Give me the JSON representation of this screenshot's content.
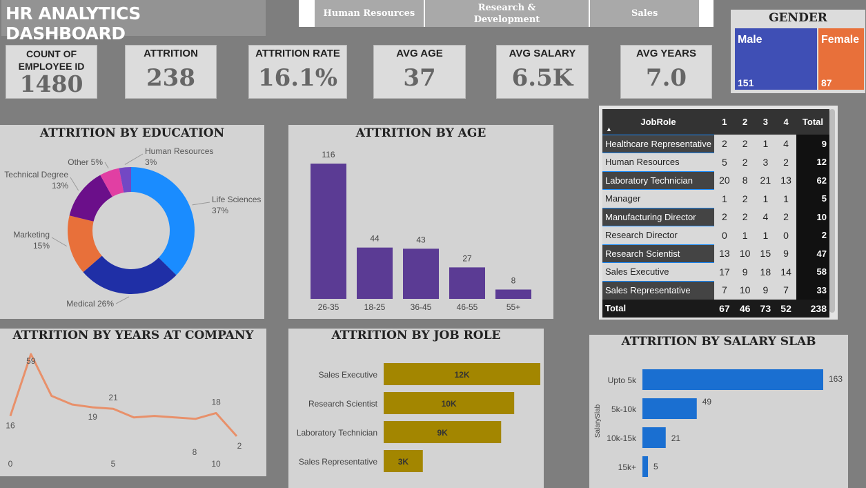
{
  "title": "HR ANALYTICS DASHBOARD",
  "tabs": [
    "Human Resources",
    "Research & Development",
    "Sales"
  ],
  "kpis": [
    {
      "label": "COUNT OF EMPLOYEE ID",
      "value": "1480"
    },
    {
      "label": "ATTRITION",
      "value": "238"
    },
    {
      "label": "ATTRITION RATE",
      "value": "16.1%"
    },
    {
      "label": "AVG AGE",
      "value": "37"
    },
    {
      "label": "AVG SALARY",
      "value": "6.5K"
    },
    {
      "label": "AVG YEARS",
      "value": "7.0"
    }
  ],
  "gender": {
    "title": "GENDER",
    "male_label": "Male",
    "male_value": "151",
    "female_label": "Female",
    "female_value": "87",
    "male_color": "#3f4fb5",
    "female_color": "#e8703a"
  },
  "education": {
    "title": "ATTRITION BY EDUCATION",
    "slices": [
      {
        "label": "Life Sciences",
        "pct_label": "37%",
        "value": 37,
        "color": "#1a8cff"
      },
      {
        "label": "Medical",
        "pct_label": "26%",
        "value": 26,
        "color": "#1f2fa6"
      },
      {
        "label": "Marketing",
        "pct_label": "15%",
        "value": 15,
        "color": "#e8703a"
      },
      {
        "label": "Technical Degree",
        "pct_label": "13%",
        "value": 13,
        "color": "#6b0f8a"
      },
      {
        "label": "Other",
        "pct_label": "5%",
        "value": 5,
        "color": "#e13fa3"
      },
      {
        "label": "Human Resources",
        "pct_label": "3%",
        "value": 3,
        "color": "#7348c4"
      }
    ]
  },
  "age": {
    "title": "ATTRITION BY AGE",
    "categories": [
      "26-35",
      "18-25",
      "36-45",
      "46-55",
      "55+"
    ],
    "values": [
      116,
      44,
      43,
      27,
      8
    ],
    "color": "#5b3b94"
  },
  "matrix": {
    "header": [
      "JobRole",
      "1",
      "2",
      "3",
      "4",
      "Total"
    ],
    "rows": [
      [
        "Healthcare Representative",
        "2",
        "2",
        "1",
        "4",
        "9"
      ],
      [
        "Human Resources",
        "5",
        "2",
        "3",
        "2",
        "12"
      ],
      [
        "Laboratory Technician",
        "20",
        "8",
        "21",
        "13",
        "62"
      ],
      [
        "Manager",
        "1",
        "2",
        "1",
        "1",
        "5"
      ],
      [
        "Manufacturing Director",
        "2",
        "2",
        "4",
        "2",
        "10"
      ],
      [
        "Research Director",
        "0",
        "1",
        "1",
        "0",
        "2"
      ],
      [
        "Research Scientist",
        "13",
        "10",
        "15",
        "9",
        "47"
      ],
      [
        "Sales Executive",
        "17",
        "9",
        "18",
        "14",
        "58"
      ],
      [
        "Sales Representative",
        "7",
        "10",
        "9",
        "7",
        "33"
      ]
    ],
    "total": [
      "Total",
      "67",
      "46",
      "73",
      "52",
      "238"
    ]
  },
  "years": {
    "title": "ATTRITION BY YEARS AT COMPANY",
    "x": [
      0,
      1,
      2,
      3,
      4,
      5,
      6,
      7,
      8,
      9,
      10,
      11
    ],
    "values": [
      16,
      59,
      30,
      24,
      22,
      21,
      15,
      16,
      15,
      14,
      18,
      2
    ],
    "labels": [
      {
        "i": 0,
        "t": "16"
      },
      {
        "i": 1,
        "t": "59"
      },
      {
        "i": 4,
        "t": "19"
      },
      {
        "i": 5,
        "t": "21"
      },
      {
        "i": 10,
        "t": "18"
      },
      {
        "i": 11,
        "t": "2"
      }
    ],
    "x_ticks": [
      "0",
      "5",
      "8",
      "10"
    ],
    "color": "#e8906a"
  },
  "jobrole": {
    "title": "ATTRITION BY JOB ROLE",
    "categories": [
      "Sales Executive",
      "Research Scientist",
      "Laboratory Technician",
      "Sales Representative"
    ],
    "values": [
      12,
      10,
      9,
      3
    ],
    "value_labels": [
      "12K",
      "10K",
      "9K",
      "3K"
    ],
    "color": "#a38600"
  },
  "salary": {
    "title": "ATTRITION BY SALARY SLAB",
    "axis_label": "SalarySlab",
    "categories": [
      "Upto 5k",
      "5k-10k",
      "10k-15k",
      "15k+"
    ],
    "values": [
      163,
      49,
      21,
      5
    ],
    "color": "#1a6fd1"
  }
}
